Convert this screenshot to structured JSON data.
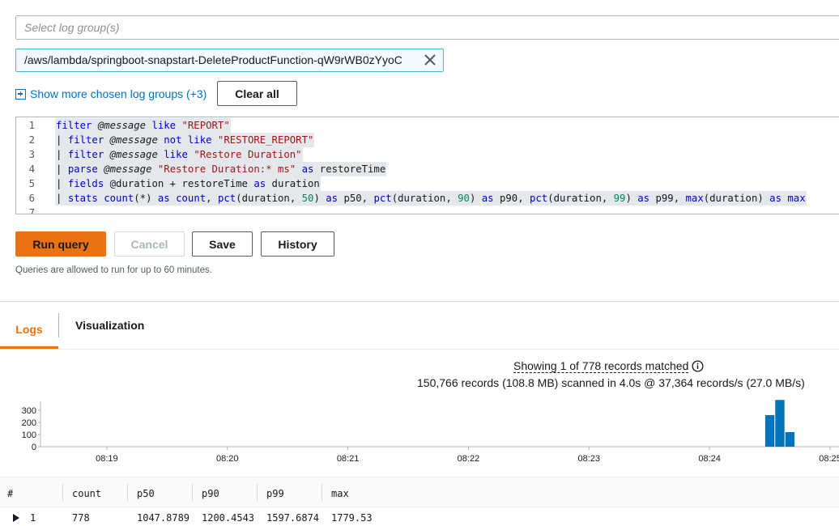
{
  "log_groups": {
    "select_placeholder": "Select log group(s)",
    "chosen": "/aws/lambda/springboot-snapstart-DeleteProductFunction-qW9rWB0zYyoC",
    "show_more_label": "Show more chosen log groups (+3)",
    "clear_all_label": "Clear all"
  },
  "editor": {
    "lines": [
      {
        "n": "1",
        "segments": [
          [
            "kw",
            "filter"
          ],
          [
            "t",
            " "
          ],
          [
            "var",
            "@message"
          ],
          [
            "t",
            " "
          ],
          [
            "kw",
            "like"
          ],
          [
            "t",
            " "
          ],
          [
            "str",
            "\"REPORT\""
          ]
        ]
      },
      {
        "n": "2",
        "segments": [
          [
            "t",
            "| "
          ],
          [
            "kw",
            "filter"
          ],
          [
            "t",
            " "
          ],
          [
            "var",
            "@message"
          ],
          [
            "t",
            " "
          ],
          [
            "kw",
            "not like"
          ],
          [
            "t",
            " "
          ],
          [
            "str",
            "\"RESTORE_REPORT\""
          ]
        ]
      },
      {
        "n": "3",
        "segments": [
          [
            "t",
            "| "
          ],
          [
            "kw",
            "filter"
          ],
          [
            "t",
            " "
          ],
          [
            "var",
            "@message"
          ],
          [
            "t",
            " "
          ],
          [
            "kw",
            "like"
          ],
          [
            "t",
            " "
          ],
          [
            "str",
            "\"Restore Duration\""
          ]
        ]
      },
      {
        "n": "4",
        "segments": [
          [
            "t",
            "| "
          ],
          [
            "kw",
            "parse"
          ],
          [
            "t",
            " "
          ],
          [
            "var",
            "@message"
          ],
          [
            "t",
            " "
          ],
          [
            "str",
            "\"Restore Duration:* ms\""
          ],
          [
            "t",
            " "
          ],
          [
            "kw",
            "as"
          ],
          [
            "t",
            " restoreTime"
          ]
        ]
      },
      {
        "n": "5",
        "segments": [
          [
            "t",
            "| "
          ],
          [
            "kw",
            "fields"
          ],
          [
            "t",
            " @duration + restoreTime "
          ],
          [
            "kw",
            "as"
          ],
          [
            "t",
            " duration"
          ]
        ]
      },
      {
        "n": "6",
        "segments": [
          [
            "t",
            "| "
          ],
          [
            "kw",
            "stats"
          ],
          [
            "t",
            " "
          ],
          [
            "fn",
            "count"
          ],
          [
            "t",
            "(*) "
          ],
          [
            "kw",
            "as"
          ],
          [
            "t",
            " "
          ],
          [
            "kw",
            "count"
          ],
          [
            "t",
            ", "
          ],
          [
            "fn",
            "pct"
          ],
          [
            "t",
            "(duration, "
          ],
          [
            "num",
            "50"
          ],
          [
            "t",
            ") "
          ],
          [
            "kw",
            "as"
          ],
          [
            "t",
            " p50, "
          ],
          [
            "fn",
            "pct"
          ],
          [
            "t",
            "(duration, "
          ],
          [
            "num",
            "90"
          ],
          [
            "t",
            ") "
          ],
          [
            "kw",
            "as"
          ],
          [
            "t",
            " p90, "
          ],
          [
            "fn",
            "pct"
          ],
          [
            "t",
            "(duration, "
          ],
          [
            "num",
            "99"
          ],
          [
            "t",
            ") "
          ],
          [
            "kw",
            "as"
          ],
          [
            "t",
            " p99, "
          ],
          [
            "fn",
            "max"
          ],
          [
            "t",
            "(duration) "
          ],
          [
            "kw",
            "as"
          ],
          [
            "t",
            " "
          ],
          [
            "kw",
            "max"
          ]
        ]
      },
      {
        "n": "7",
        "segments": []
      }
    ]
  },
  "buttons": {
    "run_query": "Run query",
    "cancel": "Cancel",
    "save": "Save",
    "history": "History"
  },
  "note": "Queries are allowed to run for up to 60 minutes.",
  "tabs": {
    "logs": "Logs",
    "visualization": "Visualization"
  },
  "summary": {
    "matched": "Showing 1 of 778 records matched",
    "scanned": "150,766 records (108.8 MB) scanned in 4.0s @ 37,364 records/s (27.0 MB/s)"
  },
  "chart_data": {
    "type": "bar",
    "title": "",
    "xlabel": "",
    "ylabel": "",
    "ylim": [
      0,
      400
    ],
    "y_ticks": [
      "0",
      "100",
      "200",
      "300"
    ],
    "x_range": [
      "08:18:27",
      "08:25:00"
    ],
    "x_ticks": [
      "08:19",
      "08:20",
      "08:21",
      "08:22",
      "08:23",
      "08:24",
      "08:25"
    ],
    "x": [
      "08:24:30",
      "08:24:35",
      "08:24:40"
    ],
    "values": [
      260,
      385,
      120
    ],
    "color": "#0073bb"
  },
  "table": {
    "headers": [
      "#",
      "count",
      "p50",
      "p90",
      "p99",
      "max"
    ],
    "rows": [
      [
        "1",
        "778",
        "1047.8789",
        "1200.4543",
        "1597.6874",
        "1779.53"
      ]
    ]
  }
}
